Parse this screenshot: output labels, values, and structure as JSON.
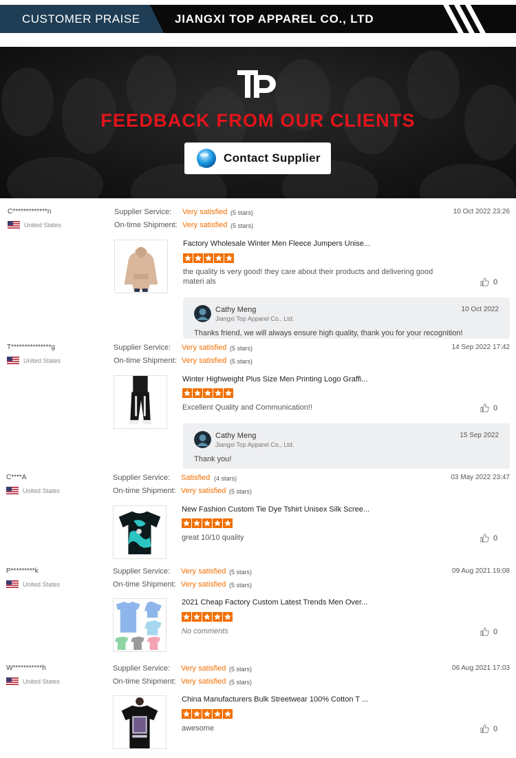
{
  "header": {
    "section_label": "CUSTOMER PRAISE",
    "company": "JIANGXI TOP APPAREL CO., LTD"
  },
  "banner": {
    "title": "FEEDBACK FROM OUR CLIENTS",
    "contact_label": "Contact Supplier"
  },
  "colors": {
    "accent_orange": "#f06f00",
    "title_red": "#e3141b",
    "header_blue": "#1f3e55"
  },
  "service_labels": {
    "supplier": "Supplier Service:",
    "shipment": "On-time Shipment:"
  },
  "reviews": [
    {
      "user": "C*************n",
      "country": "United States",
      "supplier_rating": "Very satisfied",
      "supplier_stars": "(5 stars)",
      "shipment_rating": "Very satisfied",
      "shipment_stars": "(5 stars)",
      "date": "10 Oct 2022 23:26",
      "product_title": "Factory Wholesale Winter Men Fleece Jumpers Unise...",
      "rating": 5,
      "comment": "the quality is very good! they care about their products and delivering good materi als",
      "likes": "0",
      "reply": {
        "name": "Cathy Meng",
        "company": "Jiangxi Top Apparel Co., Ltd.",
        "date": "10 Oct 2022",
        "text": "Thanks friend, we will always ensure high quality, thank you for your recognition!"
      }
    },
    {
      "user": "T***************g",
      "country": "United States",
      "supplier_rating": "Very satisfied",
      "supplier_stars": "(5 stars)",
      "shipment_rating": "Very satisfied",
      "shipment_stars": "(5 stars)",
      "date": "14 Sep 2022 17:42",
      "product_title": "Winter Highweight Plus Size Men Printing Logo Graffi...",
      "rating": 5,
      "comment": "Excellent Quality and Communication!!",
      "likes": "0",
      "reply": {
        "name": "Cathy Meng",
        "company": "Jiangxi Top Apparel Co., Ltd.",
        "date": "15 Sep 2022",
        "text": "Thank you!"
      }
    },
    {
      "user": "C****A",
      "country": "United States",
      "supplier_rating": "Satisfied",
      "supplier_stars": "(4 stars)",
      "shipment_rating": "Very satisfied",
      "shipment_stars": "(5 stars)",
      "date": "03 May 2022 23:47",
      "product_title": "New Fashion Custom Tie Dye Tshirt Unisex Silk Scree...",
      "rating": 5,
      "comment": "great 10/10 quality",
      "likes": "0"
    },
    {
      "user": "P*********k",
      "country": "United States",
      "supplier_rating": "Very satisfied",
      "supplier_stars": "(5 stars)",
      "shipment_rating": "Very satisfied",
      "shipment_stars": "(5 stars)",
      "date": "09 Aug 2021 19:08",
      "product_title": "2021 Cheap Factory Custom Latest Trends Men Over...",
      "rating": 5,
      "comment": "No comments",
      "likes": "0"
    },
    {
      "user": "W***********h",
      "country": "United States",
      "supplier_rating": "Very satisfied",
      "supplier_stars": "(5 stars)",
      "shipment_rating": "Very satisfied",
      "shipment_stars": "(5 stars)",
      "date": "06 Aug 2021 17:03",
      "product_title": "China Manufacturers Bulk Streetwear 100% Cotton T ...",
      "rating": 5,
      "comment": "awesome",
      "likes": "0"
    }
  ]
}
